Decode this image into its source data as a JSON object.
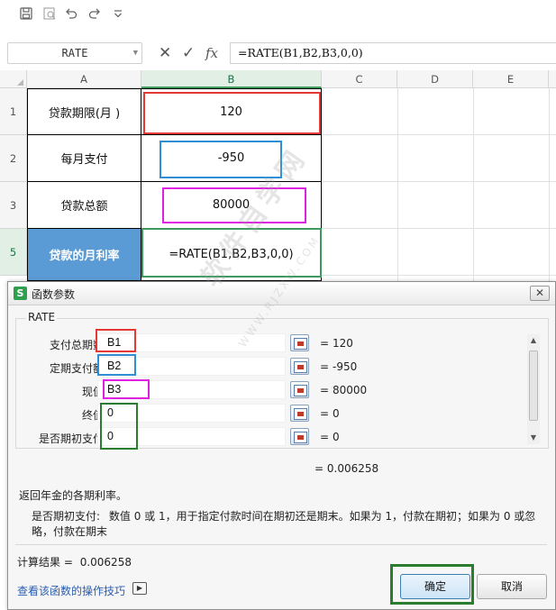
{
  "formula_bar": {
    "name_box": "RATE",
    "formula": "=RATE(B1,B2,B3,0,0)",
    "fx_label": "fx"
  },
  "columns": [
    "A",
    "B",
    "C",
    "D",
    "E"
  ],
  "rows": [
    {
      "number": "1",
      "a": "贷款期限(月 )",
      "b": "120"
    },
    {
      "number": "2",
      "a": "每月支付",
      "b": "-950"
    },
    {
      "number": "3",
      "a": "贷款总额",
      "b": "80000"
    },
    {
      "number": "5",
      "a": "贷款的月利率",
      "b": "=RATE(B1,B2,B3,0,0)"
    }
  ],
  "colors": {
    "selected_row_bg": "#5b9bd5",
    "red_highlight": "#e53935",
    "blue_highlight": "#2e8fd6",
    "magenta_highlight": "#e020e0",
    "green_highlight": "#2a7d2e"
  },
  "dialog": {
    "title": "函数参数",
    "function_name": "RATE",
    "args": [
      {
        "label": "支付总期数",
        "value": "B1",
        "result": "120"
      },
      {
        "label": "定期支付额",
        "value": "B2",
        "result": "-950"
      },
      {
        "label": "现值",
        "value": "B3",
        "result": "80000"
      },
      {
        "label": "终值",
        "value": "0",
        "result": "0"
      },
      {
        "label": "是否期初支付",
        "value": "0",
        "result": "0"
      }
    ],
    "equals": "=",
    "total_result": "= 0.006258",
    "description": "返回年金的各期利率。",
    "param_desc_label": "是否期初支付:",
    "param_desc_text": "数值 0 或 1，用于指定付款时间在期初还是期末。如果为 1，付款在期初；如果为 0 或忽略，付款在期末",
    "calc_result_label": "计算结果 =",
    "calc_result_value": "0.006258",
    "help_link": "查看该函数的操作技巧",
    "ok_label": "确定",
    "cancel_label": "取消"
  },
  "watermark": {
    "text": "软件自学网",
    "url": "WWW.RJZXW.COM"
  }
}
